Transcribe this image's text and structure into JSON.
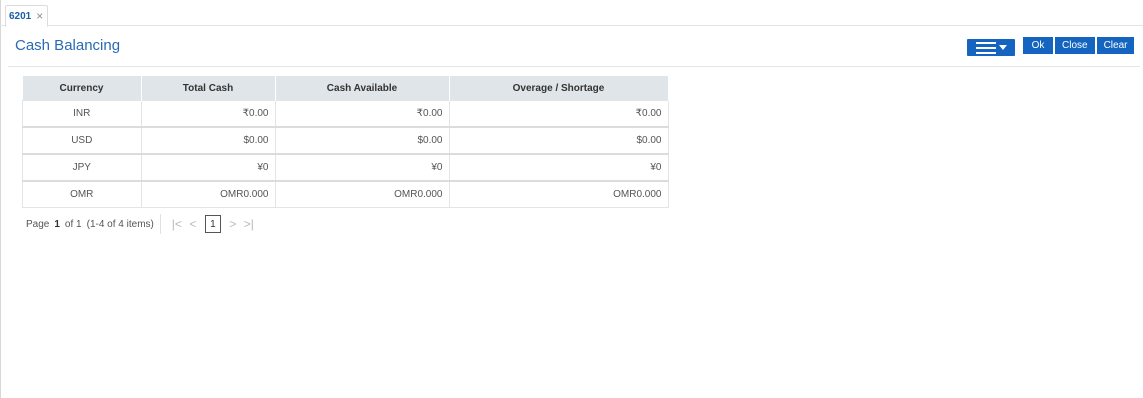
{
  "tab": {
    "label": "6201",
    "close_glyph": "×"
  },
  "page": {
    "title": "Cash Balancing"
  },
  "toolbar": {
    "menu_icon": "hamburger-menu-icon",
    "ok_label": "Ok",
    "close_label": "Close",
    "clear_label": "Clear",
    "accent_color": "#1565c0"
  },
  "table": {
    "headers": [
      "Currency",
      "Total Cash",
      "Cash Available",
      "Overage / Shortage"
    ],
    "rows": [
      {
        "currency": "INR",
        "total_cash": "₹0.00",
        "cash_available": "₹0.00",
        "overage_shortage": "₹0.00"
      },
      {
        "currency": "USD",
        "total_cash": "$0.00",
        "cash_available": "$0.00",
        "overage_shortage": "$0.00"
      },
      {
        "currency": "JPY",
        "total_cash": "¥0",
        "cash_available": "¥0",
        "overage_shortage": "¥0"
      },
      {
        "currency": "OMR",
        "total_cash": "OMR0.000",
        "cash_available": "OMR0.000",
        "overage_shortage": "OMR0.000"
      }
    ]
  },
  "pager": {
    "page_label": "Page",
    "current_page": "1",
    "of_label": "of 1",
    "items_info": "(1-4 of 4 items)",
    "first_glyph": "|<",
    "prev_glyph": "<",
    "page_input_value": "1",
    "next_glyph": ">",
    "last_glyph": ">|"
  }
}
